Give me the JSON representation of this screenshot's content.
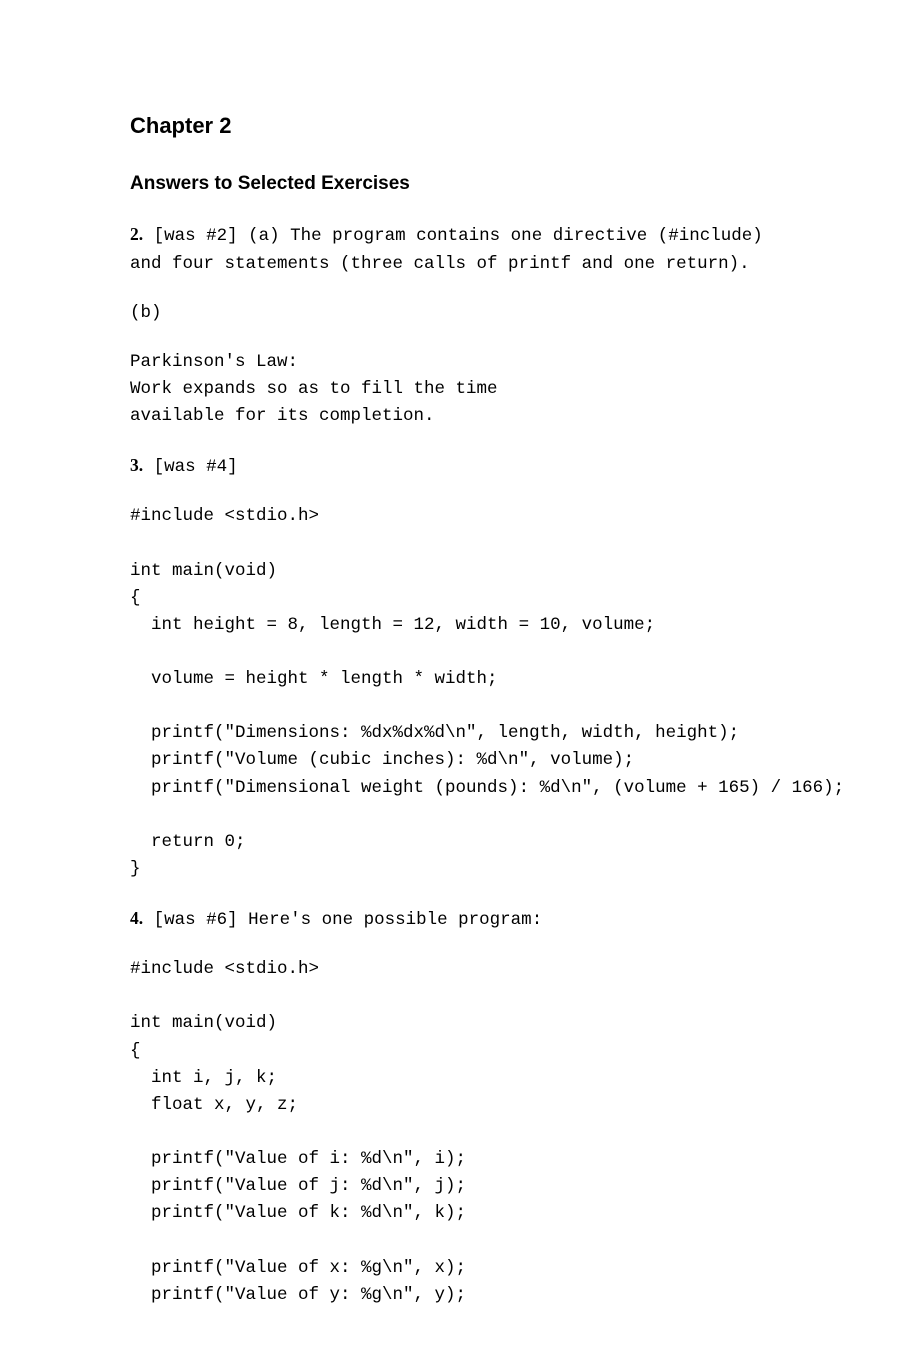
{
  "chapter_title": "Chapter 2",
  "section_title": "Answers to Selected Exercises",
  "q2": {
    "num": "2.",
    "text_a": " [was #2] (a) The program contains one directive (#include) and four statements (three calls of printf and one return).",
    "text_b": "(b)",
    "output": "Parkinson's Law:\nWork expands so as to fill the time\navailable for its completion."
  },
  "q3": {
    "num": "3.",
    "text": " [was #4]",
    "code": "#include <stdio.h>\n\nint main(void)\n{\n  int height = 8, length = 12, width = 10, volume;\n\n  volume = height * length * width;\n\n  printf(\"Dimensions: %dx%dx%d\\n\", length, width, height);\n  printf(\"Volume (cubic inches): %d\\n\", volume);\n  printf(\"Dimensional weight (pounds): %d\\n\", (volume + 165) / 166);\n\n  return 0;\n}"
  },
  "q4": {
    "num": "4.",
    "text": " [was #6] Here's one possible program:",
    "code": "#include <stdio.h>\n\nint main(void)\n{\n  int i, j, k;\n  float x, y, z;\n\n  printf(\"Value of i: %d\\n\", i);\n  printf(\"Value of j: %d\\n\", j);\n  printf(\"Value of k: %d\\n\", k);\n\n  printf(\"Value of x: %g\\n\", x);\n  printf(\"Value of y: %g\\n\", y);"
  }
}
